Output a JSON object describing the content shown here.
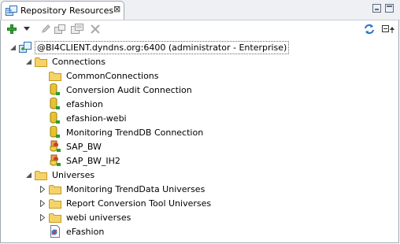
{
  "panel": {
    "tab_title": "Repository Resources",
    "close_glyph": "⊠"
  },
  "toolbar": {
    "icons": [
      "add-icon",
      "dropdown-arrow-icon",
      "edit-icon",
      "new-folder-icon",
      "copy-icon",
      "delete-icon",
      "refresh-icon",
      "collapse-all-icon"
    ]
  },
  "tree": {
    "root": {
      "label": "@BI4CLIENT.dyndns.org:6400 (administrator - Enterprise)"
    },
    "connections": {
      "label": "Connections",
      "items": [
        {
          "label": "CommonConnections",
          "icon": "folder-icon"
        },
        {
          "label": "Conversion Audit Connection",
          "icon": "relational-connection-icon"
        },
        {
          "label": "efashion",
          "icon": "relational-connection-icon"
        },
        {
          "label": "efashion-webi",
          "icon": "relational-connection-icon"
        },
        {
          "label": "Monitoring TrendDB Connection",
          "icon": "relational-connection-icon"
        },
        {
          "label": "SAP_BW",
          "icon": "olap-connection-icon"
        },
        {
          "label": "SAP_BW_IH2",
          "icon": "olap-connection-icon"
        }
      ]
    },
    "universes": {
      "label": "Universes",
      "items": [
        {
          "label": "Monitoring TrendData Universes",
          "icon": "folder-icon"
        },
        {
          "label": "Report Conversion Tool Universes",
          "icon": "folder-icon"
        },
        {
          "label": "webi universes",
          "icon": "folder-icon"
        },
        {
          "label": "eFashion",
          "icon": "universe-icon"
        }
      ]
    }
  },
  "colors": {
    "folder": "#f2c94c",
    "connection": "#c9a80c",
    "add": "#2e9b2e",
    "refresh": "#2a72c8"
  }
}
